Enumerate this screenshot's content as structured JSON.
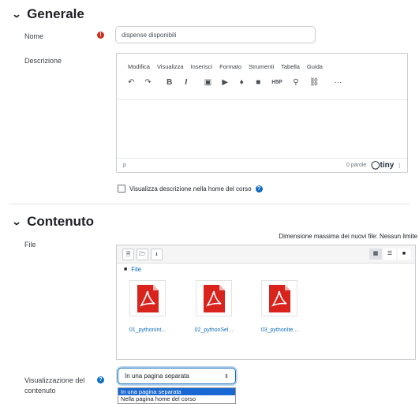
{
  "generale": {
    "title": "Generale",
    "name_label": "Nome",
    "name_value": "dispense disponibili",
    "desc_label": "Descrizione",
    "menu": [
      "Modifica",
      "Visualizza",
      "Inserisci",
      "Formato",
      "Strumenti",
      "Tabella",
      "Guida"
    ],
    "toolbar_icons": [
      "undo-icon",
      "redo-icon",
      "bold-icon",
      "italic-icon",
      "image-icon",
      "media-icon",
      "microphone-icon",
      "video-icon",
      "h5p-icon",
      "link-icon",
      "unlink-icon",
      "more-icon"
    ],
    "toolbar_glyphs": [
      "↶",
      "↷",
      "B",
      "I",
      "▣",
      "▶",
      "♦",
      "■",
      "H5P",
      "⚲",
      "⛓",
      "···"
    ],
    "status_path": "p",
    "word_count": "0 parole",
    "tiny_brand": "tiny",
    "show_desc_label": "Visualizza descrizione nella home del corso"
  },
  "contenuto": {
    "title": "Contenuto",
    "file_label": "File",
    "max_size": "Dimensione massima dei nuovi file: Nessun limite",
    "folder_crumb": "File",
    "files": [
      {
        "name": "01_pythonInt..."
      },
      {
        "name": "02_pythonSel..."
      },
      {
        "name": "03_pythonIte..."
      }
    ],
    "display_label": "Visualizzazione del contenuto",
    "display_value": "In una pagina separata",
    "display_options": [
      "In una pagina separata",
      "Nella pagina home del corso"
    ]
  },
  "colors": {
    "accent": "#0f6cbf",
    "required": "#ca3120",
    "pdf_red": "#d9231d",
    "selected_option": "#1967d2"
  }
}
